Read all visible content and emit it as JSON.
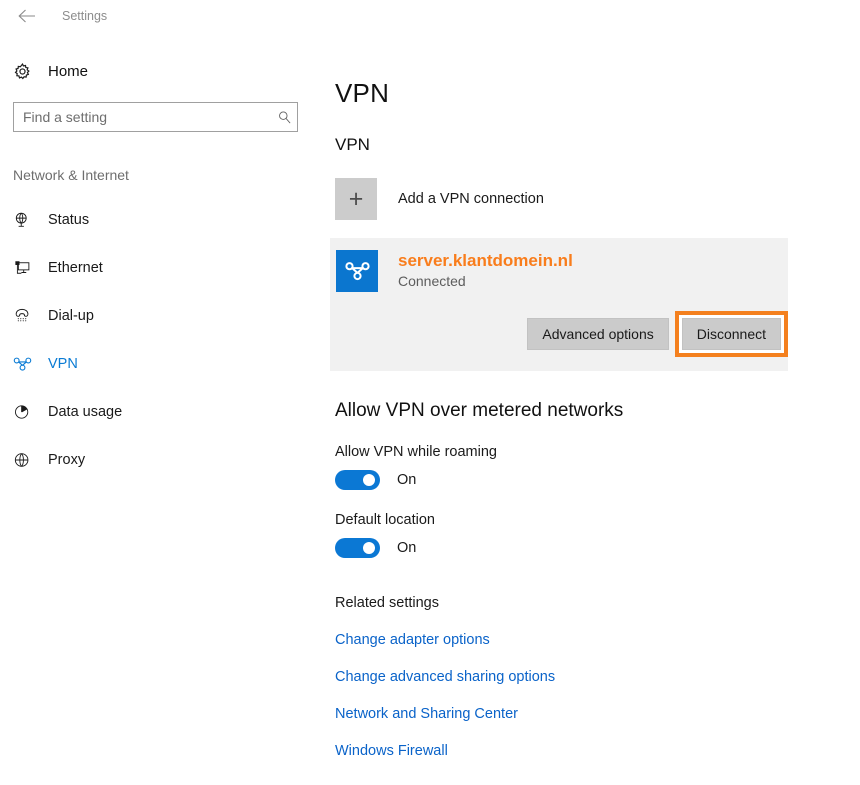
{
  "titlebar": {
    "back_icon": "back-arrow-icon",
    "title": "Settings"
  },
  "sidebar": {
    "home": {
      "label": "Home",
      "icon": "gear-icon"
    },
    "search": {
      "placeholder": "Find a setting",
      "value": "",
      "icon": "search-icon"
    },
    "group_title": "Network & Internet",
    "items": [
      {
        "label": "Status",
        "icon": "globe-status-icon",
        "selected": false
      },
      {
        "label": "Ethernet",
        "icon": "ethernet-icon",
        "selected": false
      },
      {
        "label": "Dial-up",
        "icon": "phone-icon",
        "selected": false
      },
      {
        "label": "VPN",
        "icon": "vpn-icon",
        "selected": true
      },
      {
        "label": "Data usage",
        "icon": "pie-chart-icon",
        "selected": false
      },
      {
        "label": "Proxy",
        "icon": "globe-icon",
        "selected": false
      }
    ]
  },
  "main": {
    "page_title": "VPN",
    "section_title": "VPN",
    "add_connection": {
      "label": "Add a VPN connection",
      "icon": "plus-icon"
    },
    "connection": {
      "icon": "vpn-connection-icon",
      "name": "server.klantdomein.nl",
      "status": "Connected",
      "advanced_label": "Advanced options",
      "disconnect_label": "Disconnect",
      "highlighted_button": "Disconnect"
    },
    "metered": {
      "title": "Allow VPN over metered networks",
      "settings": [
        {
          "label": "Allow VPN while roaming",
          "state": "On",
          "on": true
        },
        {
          "label": "Default location",
          "state": "On",
          "on": true
        }
      ]
    },
    "related": {
      "title": "Related settings",
      "links": [
        "Change adapter options",
        "Change advanced sharing options",
        "Network and Sharing Center",
        "Windows Firewall"
      ]
    }
  },
  "colors": {
    "accent_blue": "#0a7bd4",
    "link_blue": "#0a63c9",
    "highlight_orange": "#f4801e",
    "connection_name_orange": "#f97d1c",
    "card_bg": "#f1f1f1",
    "button_gray": "#cbcbcb"
  }
}
